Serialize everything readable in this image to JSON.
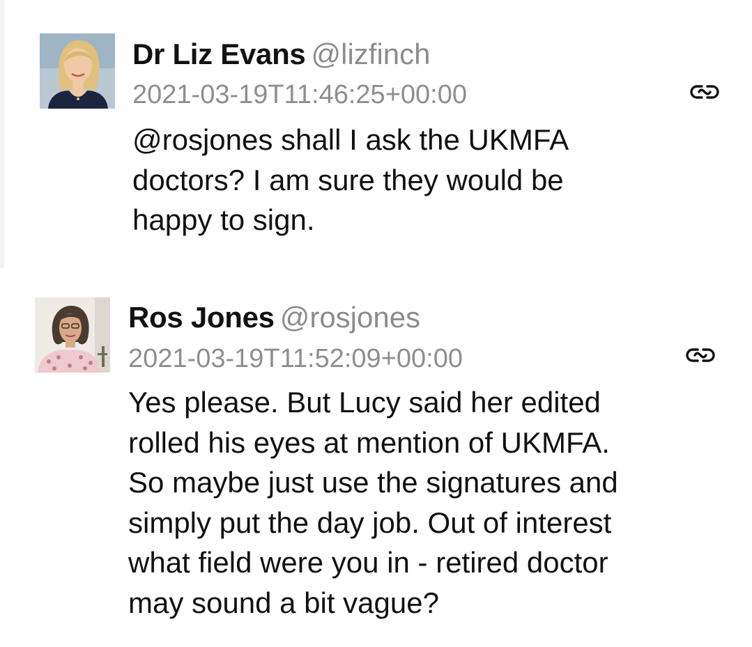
{
  "tweets": [
    {
      "display_name": "Dr Liz Evans",
      "handle": "@lizfinch",
      "timestamp": "2021-03-19T11:46:25+00:00",
      "text": "@rosjones shall I ask the UKMFA\ndoctors?  I am sure they would be\nhappy to sign.",
      "avatar_icon": "profile-photo-icon",
      "permalink_icon": "link-icon"
    },
    {
      "display_name": "Ros Jones",
      "handle": "@rosjones",
      "timestamp": "2021-03-19T11:52:09+00:00",
      "text": "Yes please.  But Lucy said her edited\nrolled his eyes at mention of UKMFA.\nSo maybe just use the signatures and\nsimply put the day job.  Out of interest\nwhat field were you in - retired doctor\nmay sound a bit vague?",
      "avatar_icon": "profile-photo-icon",
      "permalink_icon": "link-icon"
    }
  ],
  "colors": {
    "background": "#ffffff",
    "text": "#111111",
    "muted": "#8e8e8e"
  }
}
